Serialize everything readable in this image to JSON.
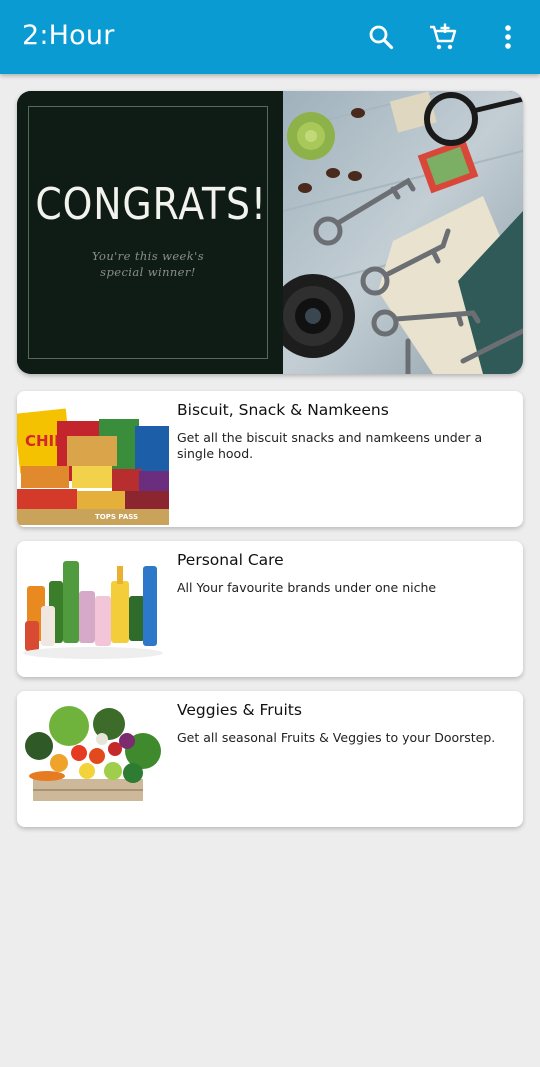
{
  "app": {
    "title": "2:Hour",
    "icons": [
      "search-icon",
      "add-to-cart-icon",
      "more-vert-icon"
    ],
    "colors": {
      "appbar": "#0a9bd3",
      "background": "#eeedee"
    }
  },
  "banner": {
    "headline": "CONGRATS!",
    "subtext_line1": "You're this week's",
    "subtext_line2": "special winner!"
  },
  "categories": [
    {
      "title": "Biscuit, Snack & Namkeens",
      "description": "Get all the biscuit snacks and namkeens under a single hood."
    },
    {
      "title": "Personal Care",
      "description": "All Your favourite brands under one niche"
    },
    {
      "title": "Veggies & Fruits",
      "description": "Get all seasonal Fruits & Veggies  to your Doorstep."
    }
  ]
}
